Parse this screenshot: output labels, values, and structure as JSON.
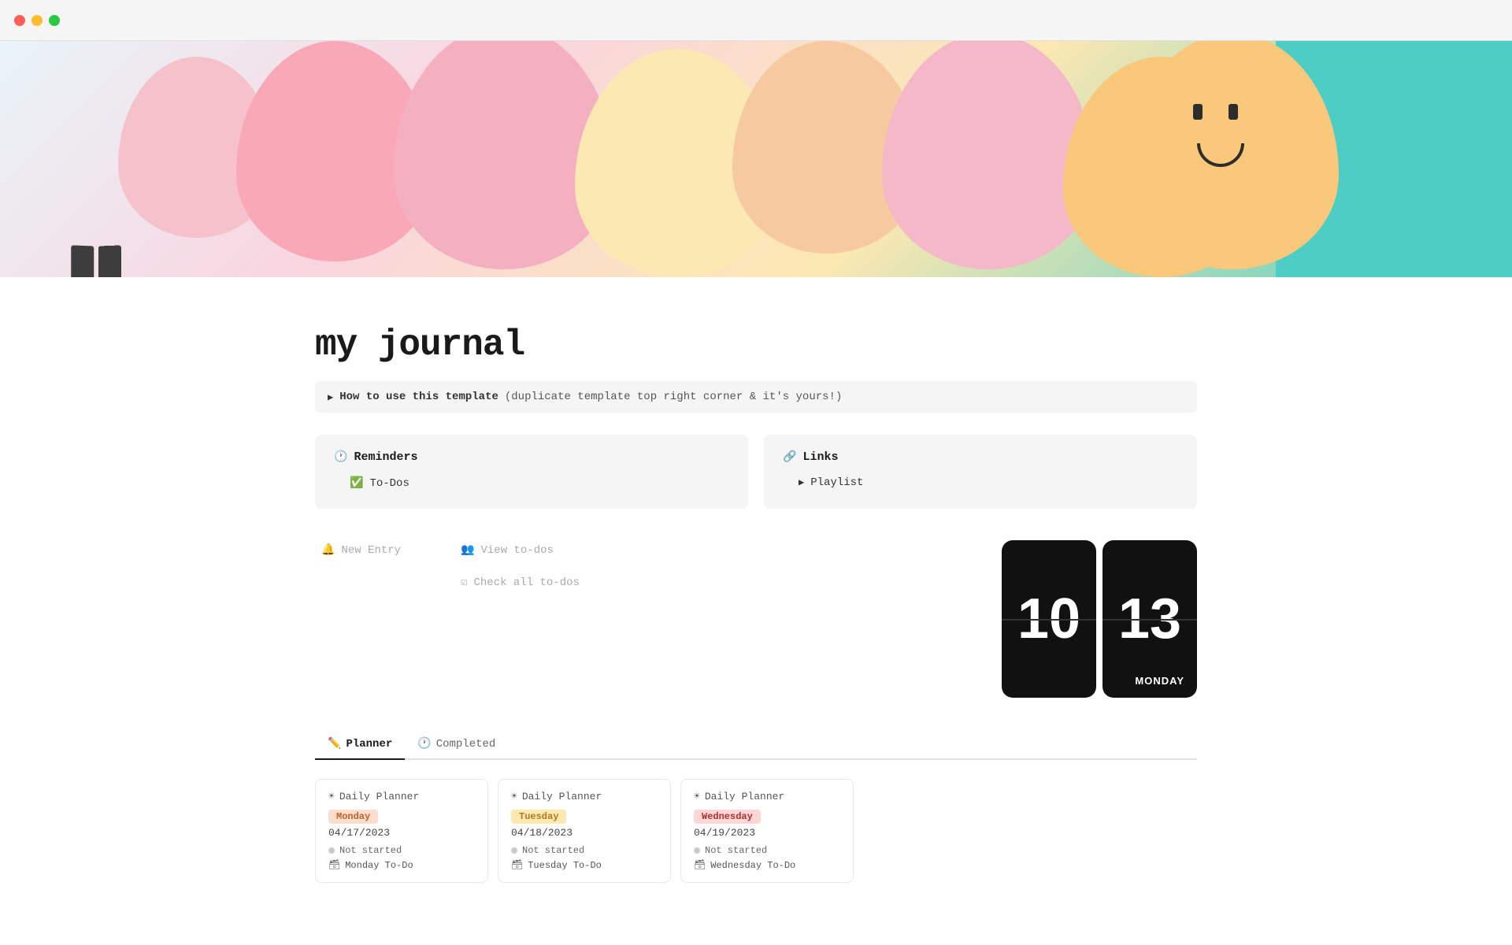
{
  "window": {
    "dots": [
      "red",
      "yellow",
      "green"
    ]
  },
  "page": {
    "title": "my journal",
    "icon": "📓"
  },
  "callout": {
    "arrow": "▶",
    "bold": "How to use this template",
    "light": "(duplicate template top right corner & it's yours!)"
  },
  "cards": {
    "reminders": {
      "header_icon": "clock",
      "header": "Reminders",
      "items": [
        {
          "icon": "check",
          "label": "To-Dos"
        }
      ]
    },
    "links": {
      "header_icon": "link",
      "header": "Links",
      "items": [
        {
          "icon": "play",
          "label": "Playlist"
        }
      ]
    }
  },
  "actions": {
    "left": [
      {
        "icon": "🔔",
        "label": "New Entry"
      }
    ],
    "mid": [
      {
        "icon": "👥",
        "label": "View to-dos"
      },
      {
        "icon": "☑",
        "label": "Check all to-dos"
      }
    ]
  },
  "clock": {
    "hour": "10",
    "minute": "13",
    "day": "MONDAY"
  },
  "tabs": [
    {
      "id": "planner",
      "icon": "✏️",
      "label": "Planner",
      "active": true
    },
    {
      "id": "completed",
      "icon": "🕐",
      "label": "Completed",
      "active": false
    }
  ],
  "planner_cards": [
    {
      "title_icon": "☀",
      "title": "Daily Planner",
      "day_badge": "Monday",
      "badge_class": "monday",
      "date": "04/17/2023",
      "status": "Not started",
      "todo": "Monday To-Do"
    },
    {
      "title_icon": "☀",
      "title": "Daily Planner",
      "day_badge": "Tuesday",
      "badge_class": "tuesday",
      "date": "04/18/2023",
      "status": "Not started",
      "todo": "Tuesday To-Do"
    },
    {
      "title_icon": "☀",
      "title": "Daily Planner",
      "day_badge": "Wednesday",
      "badge_class": "wednesday",
      "date": "04/19/2023",
      "status": "Not started",
      "todo": "Wednesday To-Do"
    }
  ]
}
